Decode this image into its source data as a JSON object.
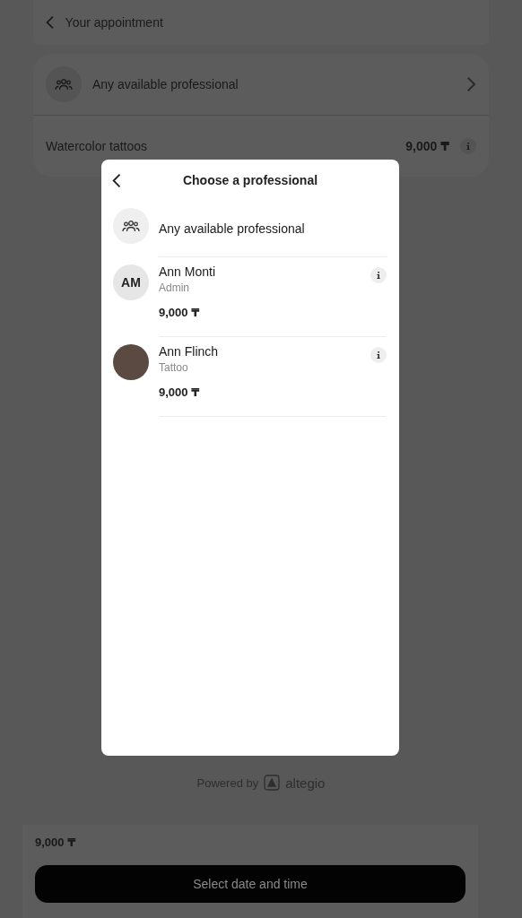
{
  "header": {
    "title": "Your appointment"
  },
  "summary": {
    "professional": "Any available professional",
    "service": "Watercolor tattoos",
    "price": "9,000 ₸"
  },
  "footer": {
    "powered_by": "Powered by",
    "brand": "altegio",
    "total": "9,000 ₸",
    "button": "Select date and time"
  },
  "dialog": {
    "title": "Choose a professional",
    "any_option": "Any available professional",
    "professionals": [
      {
        "kind": "initials",
        "initials": "AM",
        "name": "Ann Monti",
        "role": "Admin",
        "price": "9,000 ₸"
      },
      {
        "kind": "photo",
        "name": "Ann Flinch",
        "role": "Tattoo",
        "price": "9,000 ₸"
      }
    ]
  }
}
